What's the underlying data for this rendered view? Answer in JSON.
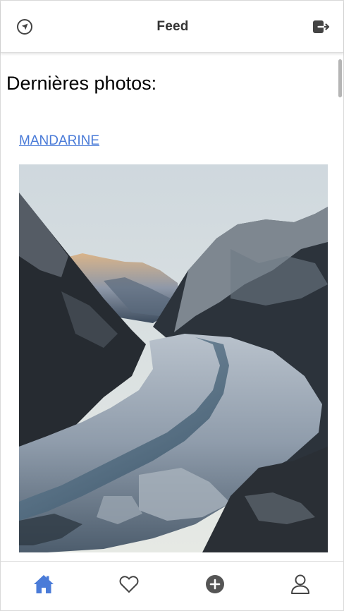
{
  "header": {
    "title": "Feed",
    "left_icon": "navigation-arrow-icon",
    "right_icon": "logout-icon"
  },
  "main": {
    "section_title": "Dernières photos:",
    "posts": [
      {
        "author": "MANDARINE",
        "photo_icon": "photo-frozen-fjord"
      }
    ]
  },
  "bottom_nav": {
    "items": [
      {
        "icon": "home-icon",
        "active": true
      },
      {
        "icon": "heart-icon",
        "active": false
      },
      {
        "icon": "add-circle-icon",
        "active": false
      },
      {
        "icon": "user-icon",
        "active": false
      }
    ]
  },
  "colors": {
    "accent": "#4a7bd8",
    "icon_inactive": "#444444",
    "link": "#4a7bd8"
  }
}
